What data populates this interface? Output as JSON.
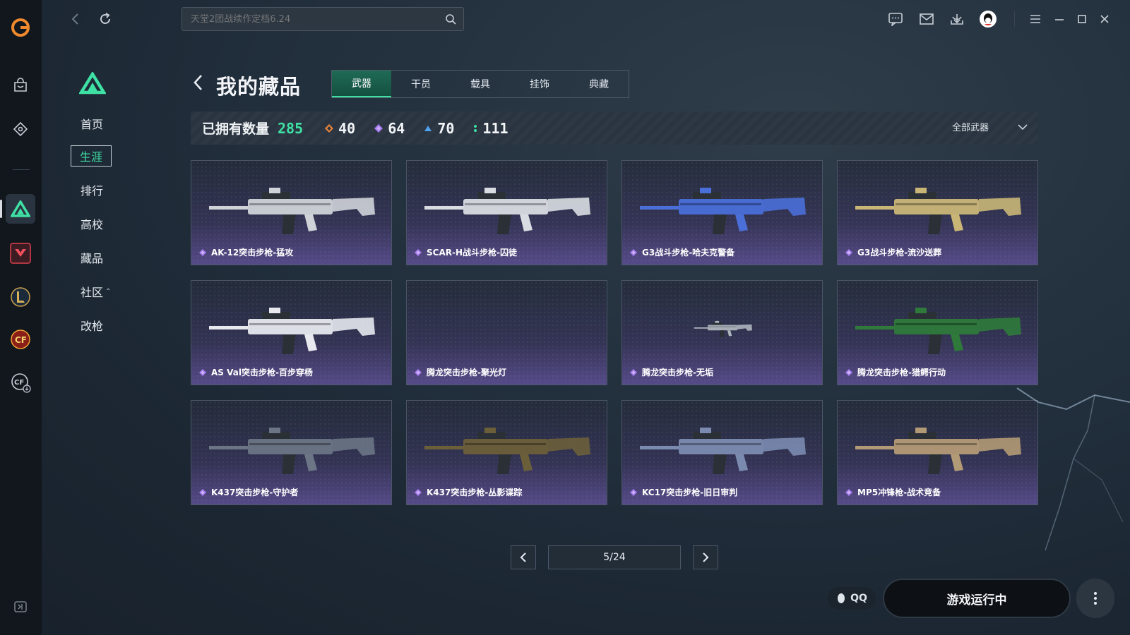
{
  "search": {
    "placeholder": "天堂2团战续作定档6.24"
  },
  "sidebar": {
    "items": [
      {
        "label": "首页"
      },
      {
        "label": "生涯"
      },
      {
        "label": "排行"
      },
      {
        "label": "高校"
      },
      {
        "label": "藏品"
      },
      {
        "label": "社区"
      },
      {
        "label": "改枪"
      }
    ],
    "active_index": 1
  },
  "page": {
    "title": "我的藏品"
  },
  "tabs": [
    {
      "label": "武器"
    },
    {
      "label": "干员"
    },
    {
      "label": "载具"
    },
    {
      "label": "挂饰"
    },
    {
      "label": "典藏"
    }
  ],
  "stats": {
    "owned_label": "已拥有数量",
    "owned_total": "285",
    "rarities": [
      {
        "count": "40",
        "color": "#e8843a",
        "icon": "diamond-icon"
      },
      {
        "count": "64",
        "color": "#a87cf0",
        "icon": "diamond-icon"
      },
      {
        "count": "70",
        "color": "#4fa3f0",
        "icon": "triangle-icon"
      },
      {
        "count": "111",
        "color": "#3ee0a4",
        "icon": "dot-icon"
      }
    ],
    "filter_label": "全部武器"
  },
  "items": [
    {
      "name": "AK-12突击步枪-猛攻",
      "tone": "#cfd3d8"
    },
    {
      "name": "SCAR-H战斗步枪-囚徒",
      "tone": "#d9dde2"
    },
    {
      "name": "G3战斗步枪-哈夫克警备",
      "tone": "#4a6fd8"
    },
    {
      "name": "G3战斗步枪-流沙送葬",
      "tone": "#c9b677"
    },
    {
      "name": "AS Val突击步枪-百步穿杨",
      "tone": "#e7e9ef"
    },
    {
      "name": "腾龙突击步枪-聚光灯",
      "tone": ""
    },
    {
      "name": "腾龙突击步枪-无垢",
      "tone": "#aeb4bc"
    },
    {
      "name": "腾龙突击步枪-猎鳄行动",
      "tone": "#2f7a3b"
    },
    {
      "name": "K437突击步枪-守护者",
      "tone": "#6c7585"
    },
    {
      "name": "K437突击步枪-丛影谍踪",
      "tone": "#6b5f3a"
    },
    {
      "name": "KC17突击步枪-旧日审判",
      "tone": "#7b8bb0"
    },
    {
      "name": "MP5冲锋枪-战术竞备",
      "tone": "#b39a76"
    }
  ],
  "pagination": {
    "current": "5/24"
  },
  "bottom": {
    "qq_label": "QQ",
    "play_label": "游戏运行中"
  }
}
